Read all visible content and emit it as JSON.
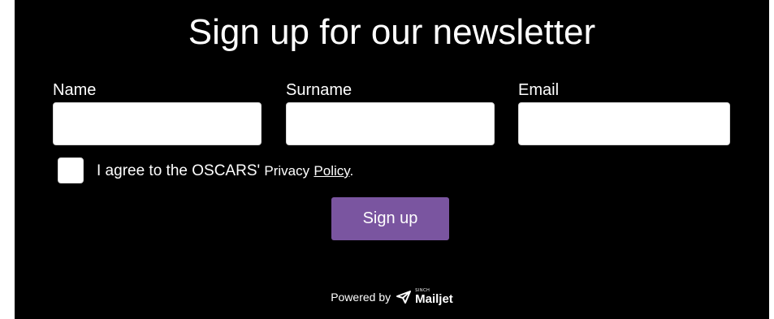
{
  "form": {
    "title": "Sign up for our newsletter",
    "fields": [
      {
        "label": "Name",
        "value": "",
        "placeholder": ""
      },
      {
        "label": "Surname",
        "value": "",
        "placeholder": ""
      },
      {
        "label": "Email",
        "value": "",
        "placeholder": ""
      }
    ],
    "consent": {
      "checked": false,
      "text_prefix": "I agree to the OSCARS'",
      "text_privacy": "Privacy",
      "link_text": "Policy",
      "text_suffix": "."
    },
    "submit_label": "Sign up"
  },
  "footer": {
    "powered_by": "Powered by",
    "brand_top": "SINCH",
    "brand_name": "Mailjet"
  },
  "colors": {
    "background": "#000000",
    "text": "#ffffff",
    "button": "#7a55a0",
    "input_bg": "#ffffff"
  },
  "icons": {
    "brand_logo": "paper-plane-icon"
  }
}
